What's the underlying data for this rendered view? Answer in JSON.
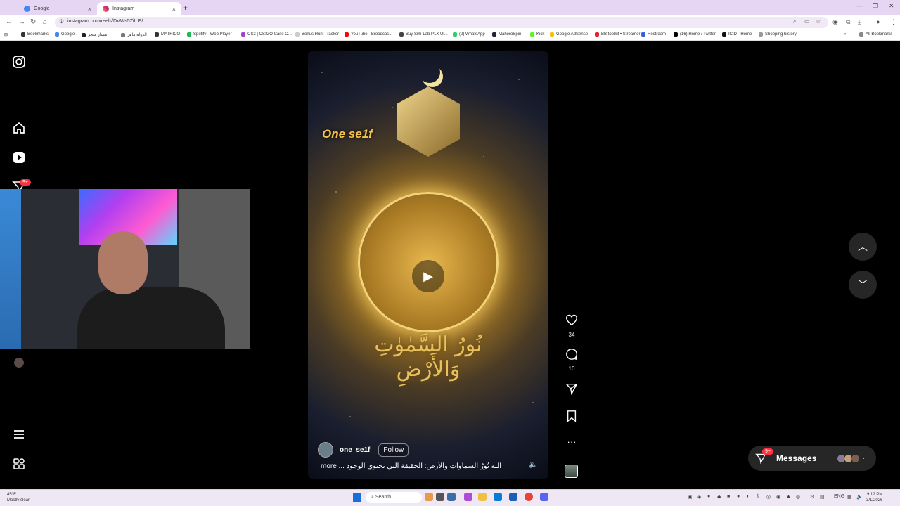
{
  "browser": {
    "tabs": [
      {
        "title": "Google",
        "active": false
      },
      {
        "title": "Instagram",
        "active": true
      }
    ],
    "url": "instagram.com/reels/DVWs5ZiIU9/",
    "bookmarks": [
      "Bookmarks",
      "Google",
      "مسار متجر",
      "الدولة ماهر",
      "MATHICO",
      "Spotify - Web Player",
      "CS2 | CS:GO Case O...",
      "Bonus Hunt Tracker",
      "YouTube - Broadcas...",
      "Buy Sim-Lab P1X Ul...",
      "(2) WhatsApp",
      "MaheroSpin",
      "Kick",
      "Google AdSense",
      "BB toolkit • Streamer",
      "Restream",
      "(16) Home / Twitter",
      "ICID - Home",
      "Shopping history"
    ],
    "all_bookmarks": "All Bookmarks"
  },
  "instagram": {
    "notifications_badge": "9+",
    "reel": {
      "overlay_text": "One se1f",
      "arabic_text": "نُورُ السَّمٰوٰتِ وَالأَرْضِ",
      "username": "one_se1f",
      "follow_label": "Follow",
      "caption": "الله نُورُ السماوات والأرض: الحقيقة التي تحتوي الوجود",
      "more_label": "more ..."
    },
    "actions": {
      "likes": "34",
      "comments": "10"
    },
    "messages": {
      "label": "Messages",
      "badge": "9+"
    }
  },
  "taskbar": {
    "weather_temp": "45°F",
    "weather_desc": "Mostly clear",
    "search_label": "Search",
    "lang": "ENG",
    "time": "9:12 PM",
    "date": "3/1/2026"
  },
  "colors": {
    "instagram_bg": "#000000",
    "badge_red": "#ff3040",
    "tabbar": "#e7d6f3"
  }
}
